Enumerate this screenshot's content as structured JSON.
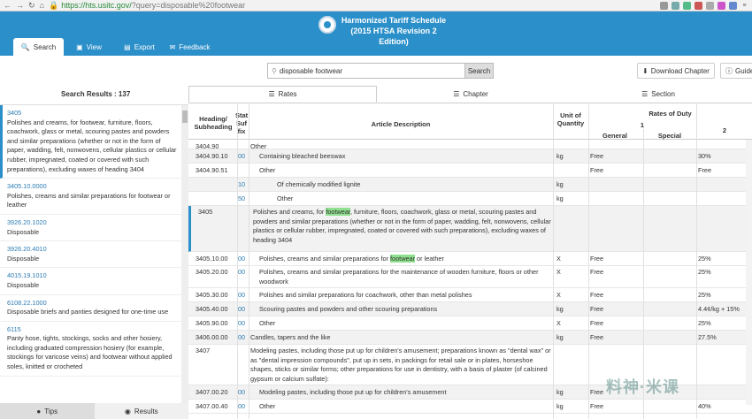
{
  "browser": {
    "url_host": "https://hts.usitc.gov/",
    "url_path": "?query=disposable%20footwear"
  },
  "header": {
    "title_line1": "Harmonized Tariff Schedule",
    "title_line2": "(2015 HTSA Revision 2 Edition)"
  },
  "nav": [
    {
      "icon": "search-icon",
      "label": "Search"
    },
    {
      "icon": "file-icon",
      "label": "View"
    },
    {
      "icon": "export-icon",
      "label": "Export"
    },
    {
      "icon": "chat-icon",
      "label": "Feedback"
    }
  ],
  "search": {
    "value": "disposable footwear",
    "button": "Search"
  },
  "buttons": {
    "download": "Download Chapter",
    "guide": "Guide"
  },
  "results": {
    "count_label": "Search Results : 137"
  },
  "result_tabs": [
    "Rates",
    "Chapter",
    "Section"
  ],
  "sidebar_items": [
    {
      "code": "3405",
      "text": "Polishes and creams, for footwear, furniture, floors, coachwork, glass or metal, scouring pastes and powders and similar preparations (whether or not in the form of paper, wadding, felt, nonwovens, cellular plastics or cellular rubber, impregnated, coated or covered with such preparations), excluding waxes of heading 3404"
    },
    {
      "code": "3405.10.0000",
      "text": "Polishes, creams and similar preparations for footwear or leather"
    },
    {
      "code": "3926.20.1020",
      "text": "Disposable"
    },
    {
      "code": "3926.20.4010",
      "text": "Disposable"
    },
    {
      "code": "4015.19.1010",
      "text": "Disposable"
    },
    {
      "code": "6108.22.1000",
      "text": "Disposable briefs and panties designed for one-time use"
    },
    {
      "code": "6115",
      "text": "Panty hose, tights, stockings, socks and other hosiery, including graduated compression hosiery (for example, stockings for varicose veins) and footwear without applied soles, knitted or crocheted"
    }
  ],
  "bottom_tabs": [
    "Tips",
    "Results"
  ],
  "table": {
    "headers": {
      "heading": "Heading/ Subheading",
      "suffix": "Stat Suf fix",
      "desc": "Article Description",
      "unit": "Unit of Quantity",
      "rates": "Rates of Duty",
      "col1": "1",
      "general": "General",
      "special": "Special",
      "col2": "2"
    },
    "rows": [
      {
        "hd": "3404.90",
        "sf": "",
        "desc": "Other",
        "unit": "",
        "gen": "",
        "two": ""
      },
      {
        "hd": "3404.90.10",
        "sf": "00",
        "desc": "Containing bleached beeswax",
        "unit": "kg",
        "gen": "Free",
        "two": "30%"
      },
      {
        "hd": "3404.90.51",
        "sf": "",
        "desc": "Other",
        "unit": "",
        "gen": "Free",
        "two": "Free"
      },
      {
        "hd": "",
        "sf": "10",
        "desc": "Of chemically modified lignite",
        "unit": "kg",
        "gen": "",
        "two": ""
      },
      {
        "hd": "",
        "sf": "50",
        "desc": "Other",
        "unit": "kg",
        "gen": "",
        "two": ""
      },
      {
        "hd": "3405",
        "sf": "",
        "desc_a": "Polishes and creams, for ",
        "desc_mark": "footwear",
        "desc_b": ", furniture, floors, coachwork, glass or metal, scouring pastes and powders and similar preparations (whether or not in the form of paper, wadding, felt, nonwovens, cellular plastics or cellular rubber, impregnated, coated or covered with such preparations), excluding waxes of heading 3404",
        "unit": "",
        "gen": "",
        "two": ""
      },
      {
        "hd": "3405.10.00",
        "sf": "00",
        "desc_a": "Polishes, creams and similar preparations for ",
        "desc_mark": "footwear",
        "desc_b": " or leather",
        "unit": "X",
        "gen": "Free",
        "two": "25%"
      },
      {
        "hd": "3405.20.00",
        "sf": "00",
        "desc": "Polishes, creams and similar preparations for the maintenance of wooden furniture, floors or other woodwork",
        "unit": "X",
        "gen": "Free",
        "two": "25%"
      },
      {
        "hd": "3405.30.00",
        "sf": "00",
        "desc": "Polishes and similar preparations for coachwork, other than metal polishes",
        "unit": "X",
        "gen": "Free",
        "two": "25%"
      },
      {
        "hd": "3405.40.00",
        "sf": "00",
        "desc": "Scouring pastes and powders and other scouring preparations",
        "unit": "kg",
        "gen": "Free",
        "two": "4.4¢/kg + 15%"
      },
      {
        "hd": "3405.90.00",
        "sf": "00",
        "desc": "Other",
        "unit": "X",
        "gen": "Free",
        "two": "25%"
      },
      {
        "hd": "3406.00.00",
        "sf": "00",
        "desc": "Candles, tapers and the like",
        "unit": "kg",
        "gen": "Free",
        "two": "27.5%"
      },
      {
        "hd": "3407",
        "sf": "",
        "desc": "Modeling pastes, including those put up for children's amusement; preparations known as \"dental wax\" or as \"dental impression compounds\", put up in sets, in packings for retail sale or in plates, horseshoe shapes, sticks or similar forms; other preparations for use in dentistry, with a basis of plaster (of calcined gypsum or calcium sulfate):",
        "unit": "",
        "gen": "",
        "two": ""
      },
      {
        "hd": "3407.00.20",
        "sf": "00",
        "desc": "Modeling pastes, including those put up for children's amusement",
        "unit": "kg",
        "gen": "Free",
        "two": ""
      },
      {
        "hd": "3407.00.40",
        "sf": "00",
        "desc": "Other",
        "unit": "kg",
        "gen": "Free",
        "two": "40%"
      }
    ]
  },
  "watermark": "料神·米课"
}
